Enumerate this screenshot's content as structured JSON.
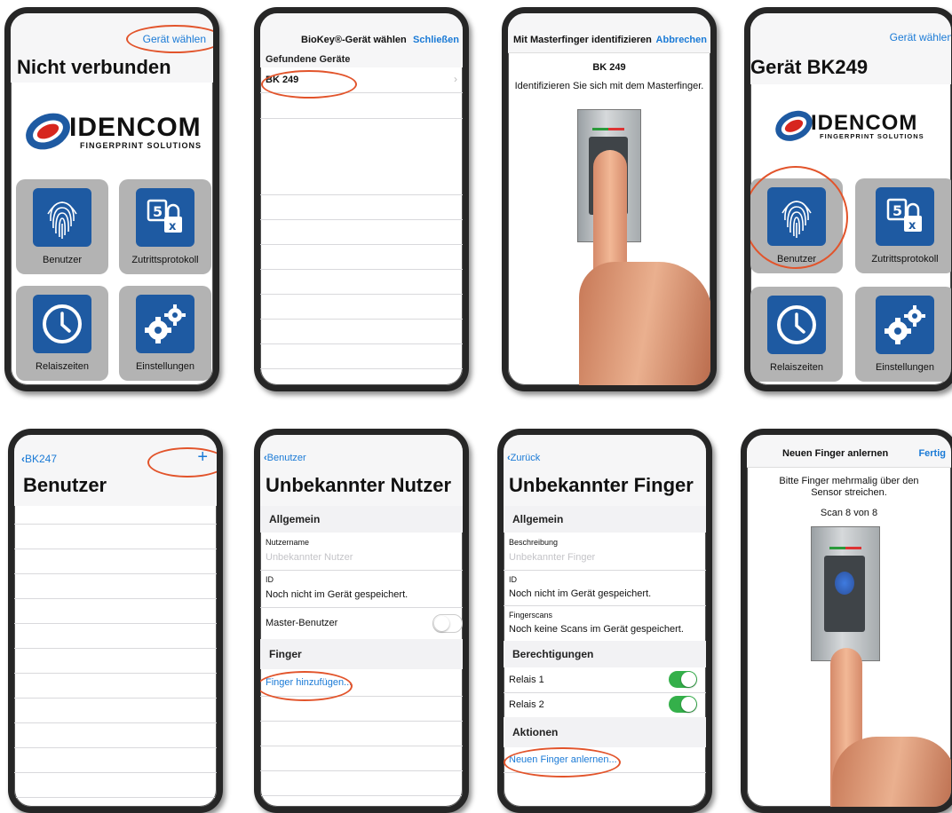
{
  "screen1": {
    "top_link": "Gerät wählen",
    "title": "Nicht verbunden",
    "logo_name": "IDENCOM",
    "logo_sub": "FINGERPRINT SOLUTIONS",
    "tiles": [
      {
        "label": "Benutzer",
        "icon": "fingerprint-icon"
      },
      {
        "label": "Zutrittsprotokoll",
        "icon": "access-log-icon"
      },
      {
        "label": "Relaiszeiten",
        "icon": "clock-icon"
      },
      {
        "label": "Einstellungen",
        "icon": "gears-icon"
      }
    ]
  },
  "screen2": {
    "title": "BioKey®-Gerät wählen",
    "close_label": "Schließen",
    "section": "Gefundene Geräte",
    "devices": [
      "BK 249"
    ]
  },
  "screen3": {
    "title": "Mit Masterfinger identifizieren",
    "cancel_label": "Abbrechen",
    "device": "BK 249",
    "instruction": "Identifizieren Sie sich mit dem Masterfinger."
  },
  "screen4": {
    "top_link": "Gerät wählen",
    "title": "Gerät BK249",
    "logo_name": "IDENCOM",
    "logo_sub": "FINGERPRINT SOLUTIONS",
    "tiles": [
      {
        "label": "Benutzer"
      },
      {
        "label": "Zutrittsprotokoll"
      },
      {
        "label": "Relaiszeiten"
      },
      {
        "label": "Einstellungen"
      }
    ]
  },
  "screen5": {
    "back_label": "BK247",
    "add_label": "+",
    "title": "Benutzer"
  },
  "screen6": {
    "back_label": "Benutzer",
    "title": "Unbekannter Nutzer",
    "section_general": "Allgemein",
    "username_label": "Nutzername",
    "username_placeholder": "Unbekannter Nutzer",
    "id_label": "ID",
    "id_value": "Noch nicht im Gerät gespeichert.",
    "master_label": "Master-Benutzer",
    "section_finger": "Finger",
    "add_finger": "Finger hinzufügen..."
  },
  "screen7": {
    "back_label": "Zurück",
    "title": "Unbekannter Finger",
    "section_general": "Allgemein",
    "desc_label": "Beschreibung",
    "desc_placeholder": "Unbekannter Finger",
    "id_label": "ID",
    "id_value": "Noch nicht im Gerät gespeichert.",
    "scans_label": "Fingerscans",
    "scans_value": "Noch keine Scans im Gerät gespeichert.",
    "section_perm": "Berechtigungen",
    "relay1": "Relais 1",
    "relay2": "Relais 2",
    "section_actions": "Aktionen",
    "learn_link": "Neuen Finger anlernen..."
  },
  "screen8": {
    "title": "Neuen Finger anlernen",
    "done_label": "Fertig",
    "instruction": "Bitte Finger mehrmalig über den Sensor streichen.",
    "progress": "Scan 8 von 8"
  },
  "colors": {
    "accent": "#1a7ad6",
    "tile_icon": "#1e5aa2",
    "tile_bg": "#b3b3b3",
    "toggle_on": "#34b04a",
    "highlight": "#e2542b"
  }
}
